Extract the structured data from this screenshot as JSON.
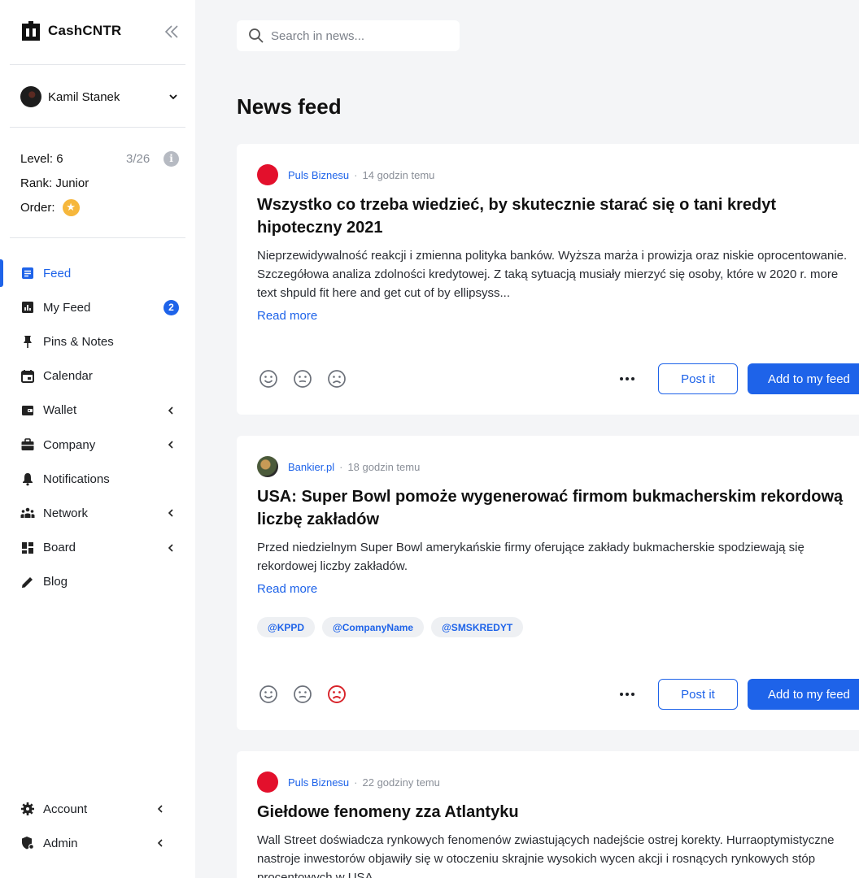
{
  "brand": {
    "name": "CashCNTR"
  },
  "user": {
    "name": "Kamil Stanek"
  },
  "stats": {
    "level_label": "Level: 6",
    "level_progress": "3/26",
    "rank_label": "Rank: Junior",
    "order_label": "Order:"
  },
  "nav": {
    "items": [
      {
        "label": "Feed",
        "icon": "document-icon"
      },
      {
        "label": "My Feed",
        "icon": "chart-icon",
        "badge": "2"
      },
      {
        "label": "Pins & Notes",
        "icon": "pin-icon"
      },
      {
        "label": "Calendar",
        "icon": "calendar-icon"
      },
      {
        "label": "Wallet",
        "icon": "wallet-icon"
      },
      {
        "label": "Company",
        "icon": "briefcase-icon"
      },
      {
        "label": "Notifications",
        "icon": "bell-icon"
      },
      {
        "label": "Network",
        "icon": "people-icon"
      },
      {
        "label": "Board",
        "icon": "dashboard-icon"
      },
      {
        "label": "Blog",
        "icon": "pencil-icon"
      }
    ],
    "bottom": [
      {
        "label": "Account",
        "icon": "gear-icon"
      },
      {
        "label": "Admin",
        "icon": "shield-icon"
      }
    ]
  },
  "search": {
    "placeholder": "Search in news..."
  },
  "page": {
    "title": "News feed"
  },
  "cards": [
    {
      "source": "Puls Biznesu",
      "time": "14 godzin temu",
      "title_line1": "Wszystko co trzeba wiedzieć, by skutecznie starać się o tani kredyt",
      "title_line2": "hipoteczny 2021",
      "text_line1": "Nieprzewidywalność reakcji i zmienna polityka banków. Wyższa marża i prowizja oraz niskie oprocentowanie.",
      "text_line2": "Szczegółowa analiza zdolności kredytowej. Z taką sytuacją musiały mierzyć się osoby, które w 2020 r. more",
      "text_line3": "text shpuld fit here and get cut of by ellipsyss...",
      "read_more": "Read more",
      "post_label": "Post it",
      "add_label": "Add to my feed"
    },
    {
      "source": "Bankier.pl",
      "time": "18 godzin temu",
      "title_line1": "USA: Super Bowl pomoże wygenerować firmom bukmacherskim rekordową",
      "title_line2": "liczbę zakładów",
      "text_line1": "Przed niedzielnym Super Bowl amerykańskie firmy oferujące zakłady bukmacherskie spodziewają się",
      "text_line2": "rekordowej liczby zakładów.",
      "read_more": "Read more",
      "tags": [
        "@KPPD",
        "@CompanyName",
        "@SMSKREDYT"
      ],
      "post_label": "Post it",
      "add_label": "Add to my feed"
    },
    {
      "source": "Puls Biznesu",
      "time": "22 godziny temu",
      "title_line1": "Giełdowe fenomeny zza Atlantyku",
      "text_line1": "Wall Street doświadcza rynkowych fenomenów zwiastujących nadejście ostrej korekty. Hurraoptymistyczne",
      "text_line2": "nastroje inwestorów objawiły się w otoczeniu skrajnie wysokich wycen akcji i rosnących rynkowych stóp",
      "text_line3": "procentowych w USA."
    }
  ],
  "colors": {
    "accent": "#1e63e9",
    "negative": "#d8232a",
    "star": "#f6b73c",
    "puls_biznesu": "#e3102c"
  }
}
